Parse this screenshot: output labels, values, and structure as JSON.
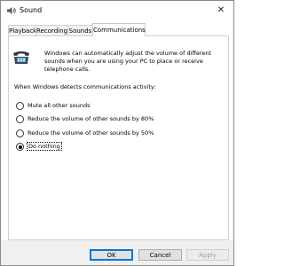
{
  "window": {
    "title": "Sound",
    "close_glyph": "✕",
    "icon": "speaker-icon"
  },
  "tabs": [
    {
      "label": "Playback",
      "active": false
    },
    {
      "label": "Recording",
      "active": false
    },
    {
      "label": "Sounds",
      "active": false
    },
    {
      "label": "Communications",
      "active": true
    }
  ],
  "intro": {
    "icon": "telephone-icon",
    "text": "Windows can automatically adjust the volume of different sounds when you are using your PC to place or receive telephone calls."
  },
  "prompt": "When Windows detects communications activity:",
  "options": [
    {
      "label": "Mute all other sounds",
      "selected": false
    },
    {
      "label": "Reduce the volume of other sounds by 80%",
      "selected": false
    },
    {
      "label": "Reduce the volume of other sounds by 50%",
      "selected": false
    },
    {
      "label": "Do nothing",
      "selected": true
    }
  ],
  "buttons": {
    "ok": "OK",
    "cancel": "Cancel",
    "apply": "Apply"
  },
  "colors": {
    "accent": "#0078d7",
    "disabled_text": "#a0a0a0"
  }
}
